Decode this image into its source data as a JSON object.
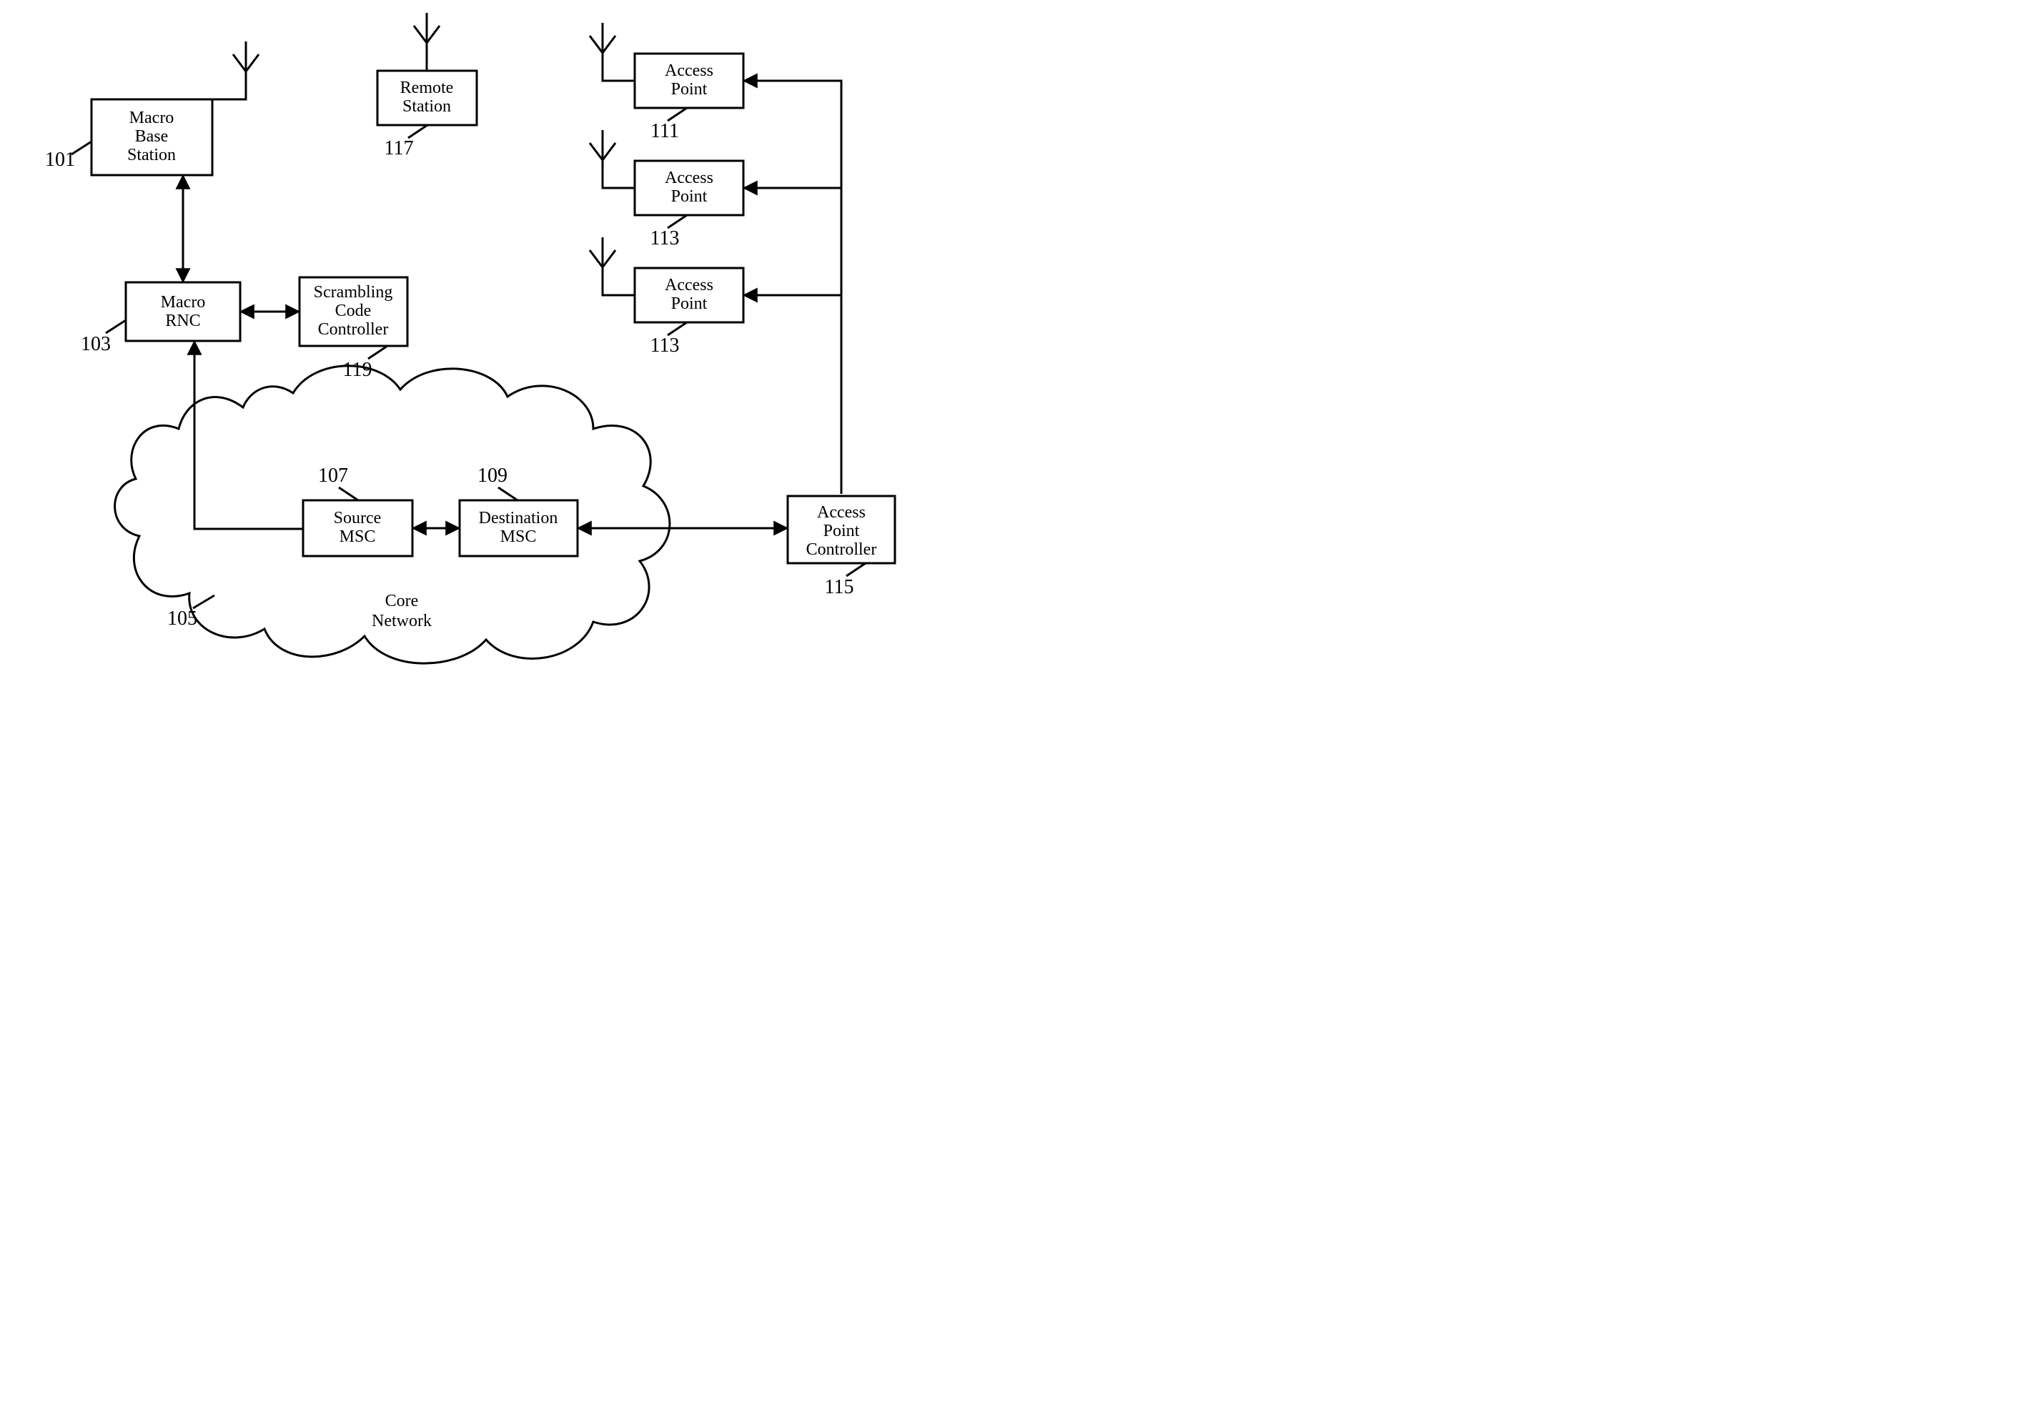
{
  "nodes": {
    "macro_base_station": {
      "label_lines": [
        "Macro",
        "Base",
        "Station"
      ],
      "ref": "101"
    },
    "remote_station": {
      "label_lines": [
        "Remote",
        "Station"
      ],
      "ref": "117"
    },
    "access_point_1": {
      "label_lines": [
        "Access",
        "Point"
      ],
      "ref": "111"
    },
    "access_point_2": {
      "label_lines": [
        "Access",
        "Point"
      ],
      "ref": "113"
    },
    "access_point_3": {
      "label_lines": [
        "Access",
        "Point"
      ],
      "ref": "113"
    },
    "macro_rnc": {
      "label_lines": [
        "Macro",
        "RNC"
      ],
      "ref": "103"
    },
    "scrambling_code_controller": {
      "label_lines": [
        "Scrambling",
        "Code",
        "Controller"
      ],
      "ref": "119"
    },
    "source_msc": {
      "label_lines": [
        "Source",
        "MSC"
      ],
      "ref": "107"
    },
    "destination_msc": {
      "label_lines": [
        "Destination",
        "MSC"
      ],
      "ref": "109"
    },
    "access_point_controller": {
      "label_lines": [
        "Access",
        "Point",
        "Controller"
      ],
      "ref": "115"
    },
    "core_network": {
      "label_lines": [
        "Core",
        "Network"
      ],
      "ref": "105"
    }
  }
}
